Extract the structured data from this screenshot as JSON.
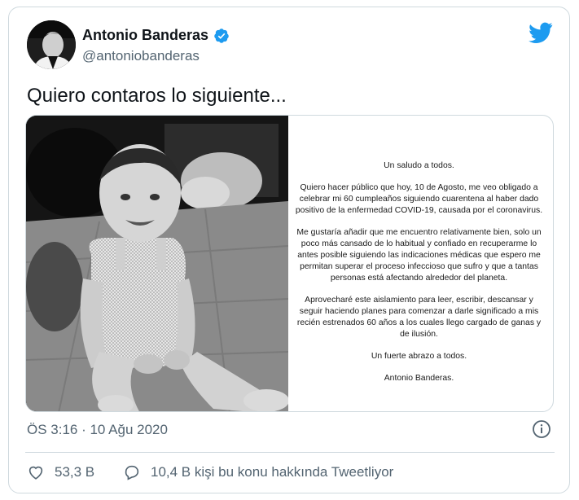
{
  "author": {
    "name": "Antonio Banderas",
    "handle": "@antoniobanderas",
    "verified": true
  },
  "tweet": {
    "text": "Quiero contaros lo siguiente..."
  },
  "letter": {
    "paragraphs": [
      "Un saludo a todos.",
      "Quiero hacer público que hoy, 10 de Agosto, me veo obligado a celebrar mi 60 cumpleaños siguiendo cuarentena al haber dado positivo de la enfermedad COVID-19, causada por el coronavirus.",
      "Me gustaría añadir que me encuentro relativamente bien, solo un poco más cansado de lo habitual y confiado en recuperarme lo antes posible siguiendo las indicaciones médicas que espero me permitan superar el proceso infeccioso que sufro y que a tantas personas está afectando alrededor del planeta.",
      "Aprovecharé este aislamiento para leer, escribir, descansar y seguir haciendo planes para comenzar a darle significado a mis recién estrenados 60 años a los cuales llego cargado de ganas y de ilusión.",
      "Un fuerte abrazo a todos.",
      "Antonio Banderas."
    ]
  },
  "meta": {
    "timestamp": "ÖS 3:16 · 10 Ağu 2020"
  },
  "actions": {
    "likes": "53,3 B",
    "conversation": "10,4 B kişi bu konu hakkında Tweetliyor"
  },
  "colors": {
    "twitter_blue": "#1d9bf0",
    "secondary_text": "#536471",
    "border": "#cfd9de"
  },
  "icons": [
    "verified-badge-icon",
    "twitter-logo-icon",
    "info-icon",
    "heart-icon",
    "speech-bubble-icon"
  ]
}
